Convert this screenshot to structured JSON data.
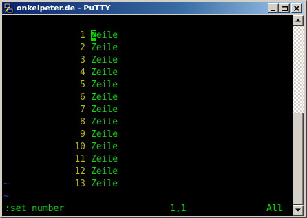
{
  "window": {
    "title": "onkelpeter.de - PuTTY",
    "icon": "putty-icon"
  },
  "titlebar_buttons": {
    "minimize": "minimize-icon",
    "maximize": "maximize-icon",
    "close": "close-icon"
  },
  "terminal": {
    "lines": [
      {
        "number": "1",
        "text": "Zeile"
      },
      {
        "number": "2",
        "text": "Zeile"
      },
      {
        "number": "3",
        "text": "Zeile"
      },
      {
        "number": "4",
        "text": "Zeile"
      },
      {
        "number": "5",
        "text": "Zeile"
      },
      {
        "number": "6",
        "text": "Zeile"
      },
      {
        "number": "7",
        "text": "Zeile"
      },
      {
        "number": "8",
        "text": "Zeile"
      },
      {
        "number": "9",
        "text": "Zeile"
      },
      {
        "number": "10",
        "text": "Zeile"
      },
      {
        "number": "11",
        "text": "Zeile"
      },
      {
        "number": "12",
        "text": "Zeile"
      },
      {
        "number": "13",
        "text": "Zeile"
      }
    ],
    "cursor_line": 1,
    "cursor_char": "Z",
    "first_line_rest": "eile",
    "tildes": [
      "~",
      "~"
    ],
    "status": {
      "command": ":set number",
      "position": "1,1",
      "scroll": "All"
    }
  },
  "colors": {
    "background": "#000000",
    "text": "#00dd00",
    "line_numbers": "#bbbb00",
    "tilde": "#3333dd",
    "title_gradient_start": "#0a246a",
    "title_gradient_end": "#a6caf0"
  }
}
